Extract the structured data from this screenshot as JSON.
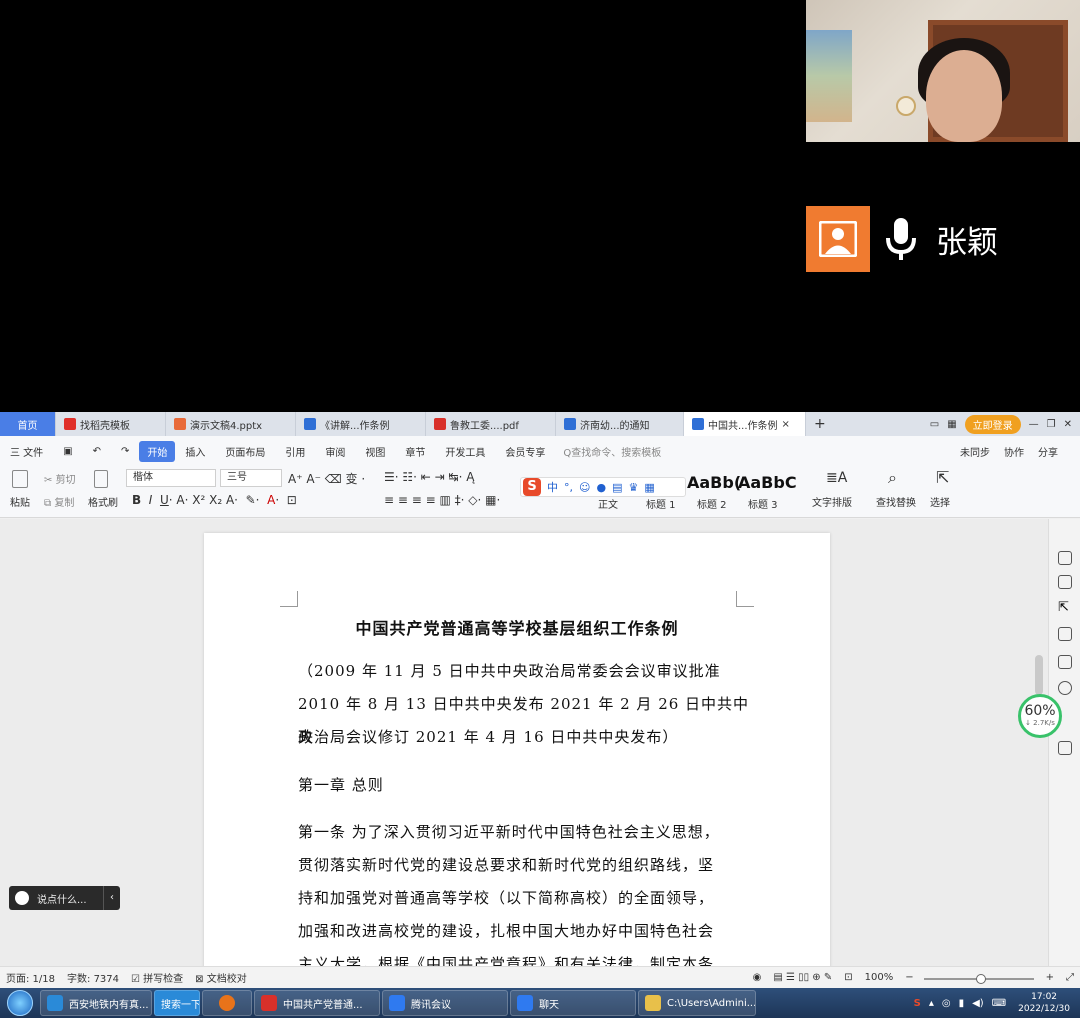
{
  "meeting": {
    "speaker_name": "张颖"
  },
  "wps": {
    "tabs": [
      {
        "label": "首页",
        "color": "#4a7ee6"
      },
      {
        "label": "找稻壳模板",
        "color": "#e0302a"
      },
      {
        "label": "演示文稿4.pptx",
        "color": "#e86a3a"
      },
      {
        "label": "《讲解...作条例",
        "color": "#2f6fd6"
      },
      {
        "label": "鲁教工委....pdf",
        "color": "#d8302a"
      },
      {
        "label": "济南幼...的通知",
        "color": "#2f6fd6"
      },
      {
        "label": "中国共...作条例",
        "color": "#2f6fd6"
      }
    ],
    "login_label": "立即登录",
    "menu": {
      "file": "三 文件",
      "items": [
        "开始",
        "插入",
        "页面布局",
        "引用",
        "审阅",
        "视图",
        "章节",
        "开发工具",
        "会员专享"
      ],
      "search_placeholder": "Q查找命令、搜索模板",
      "sync": "未同步",
      "collab": "协作",
      "share": "分享"
    },
    "ribbon": {
      "paste": "粘贴",
      "cut": "剪切",
      "copy": "复制",
      "format_painter": "格式刷",
      "font_name": "楷体",
      "font_size": "三号",
      "styles": [
        {
          "preview": "AaBb(",
          "label": "标题 2"
        },
        {
          "preview": "AaBbC",
          "label": "标题 3"
        }
      ],
      "style_normal": "正文",
      "style_h1": "标题 1",
      "text_layout": "文字排版",
      "find_replace": "查找替换",
      "select": "选择"
    },
    "ime_label": "中"
  },
  "document": {
    "title": "中国共产党普通高等学校基层组织工作条例",
    "lines_preamble": [
      "（2009 年 11 月 5 日中共中央政治局常委会会议审议批准",
      "2010 年 8 月 13 日中共中央发布  2021 年 2 月 26 日中共中央",
      "政治局会议修订  2021 年 4 月 16 日中共中央发布）"
    ],
    "chapter": "第一章  总则",
    "lines_body": [
      "第一条  为了深入贯彻习近平新时代中国特色社会主义思想，",
      "贯彻落实新时代党的建设总要求和新时代党的组织路线，坚",
      "持和加强党对普通高等学校（以下简称高校）的全面领导，",
      "加强和改进高校党的建设，扎根中国大地办好中国特色社会",
      "主义大学，根据《中国共产党章程》和有关法律，制定本条"
    ]
  },
  "speed": {
    "percent": "60%",
    "rate": "↓ 2.7K/s"
  },
  "chat": {
    "placeholder": "说点什么..."
  },
  "status": {
    "page": "页面: 1/18",
    "words": "字数: 7374",
    "spellcheck": "拼写检查",
    "proofread": "文档校对",
    "zoom": "100%"
  },
  "taskbar": {
    "items": [
      {
        "label": "西安地铁内有真...",
        "color": "#2a8ad8"
      },
      {
        "label": "搜索一下",
        "color": "#2a8ad8"
      },
      {
        "label": "",
        "color": "#e8731a"
      },
      {
        "label": "中国共产党普通...",
        "color": "#d8302a"
      },
      {
        "label": "腾讯会议",
        "color": "#2f7af0"
      },
      {
        "label": "聊天",
        "color": "#2f7af0"
      },
      {
        "label": "C:\\Users\\Admini...",
        "color": "#e8c04a"
      }
    ],
    "time": "17:02",
    "date": "2022/12/30"
  }
}
